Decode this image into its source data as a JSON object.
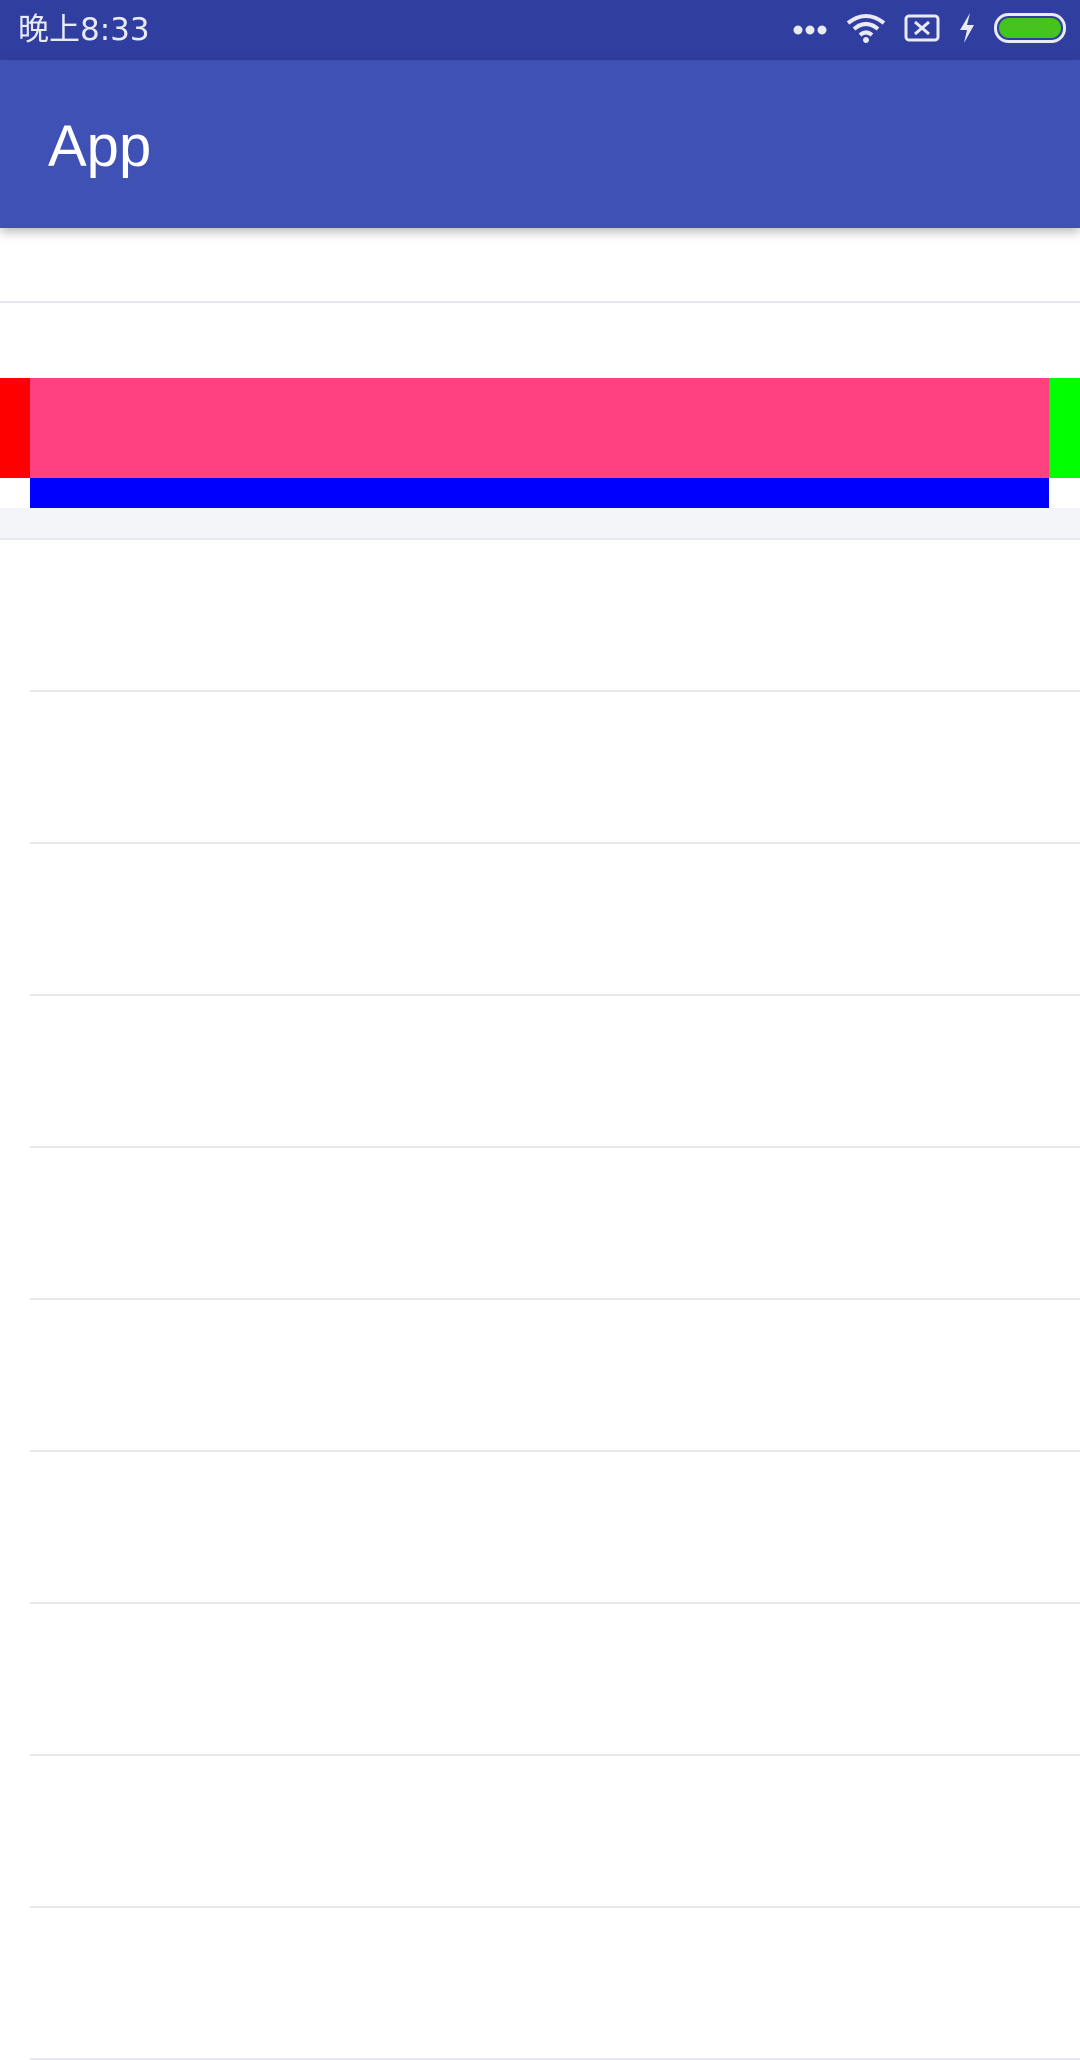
{
  "status_bar": {
    "time": "晚上8:33",
    "background": "#303f9f",
    "icons": [
      "more-dots-icon",
      "wifi-icon",
      "no-sim-icon",
      "charging-icon",
      "battery-icon"
    ],
    "battery_color": "#44c41c"
  },
  "app_bar": {
    "title": "App",
    "background": "#3f51b5"
  },
  "colors": {
    "red_block": "#ff0000",
    "pink_block": "#ff4081",
    "green_block": "#00ff00",
    "blue_block": "#0000ff",
    "divider": "#e6e8ef",
    "band": "#f4f5f9"
  },
  "list": {
    "items": [
      "",
      "",
      "",
      "",
      "",
      "",
      "",
      "",
      "",
      ""
    ]
  }
}
